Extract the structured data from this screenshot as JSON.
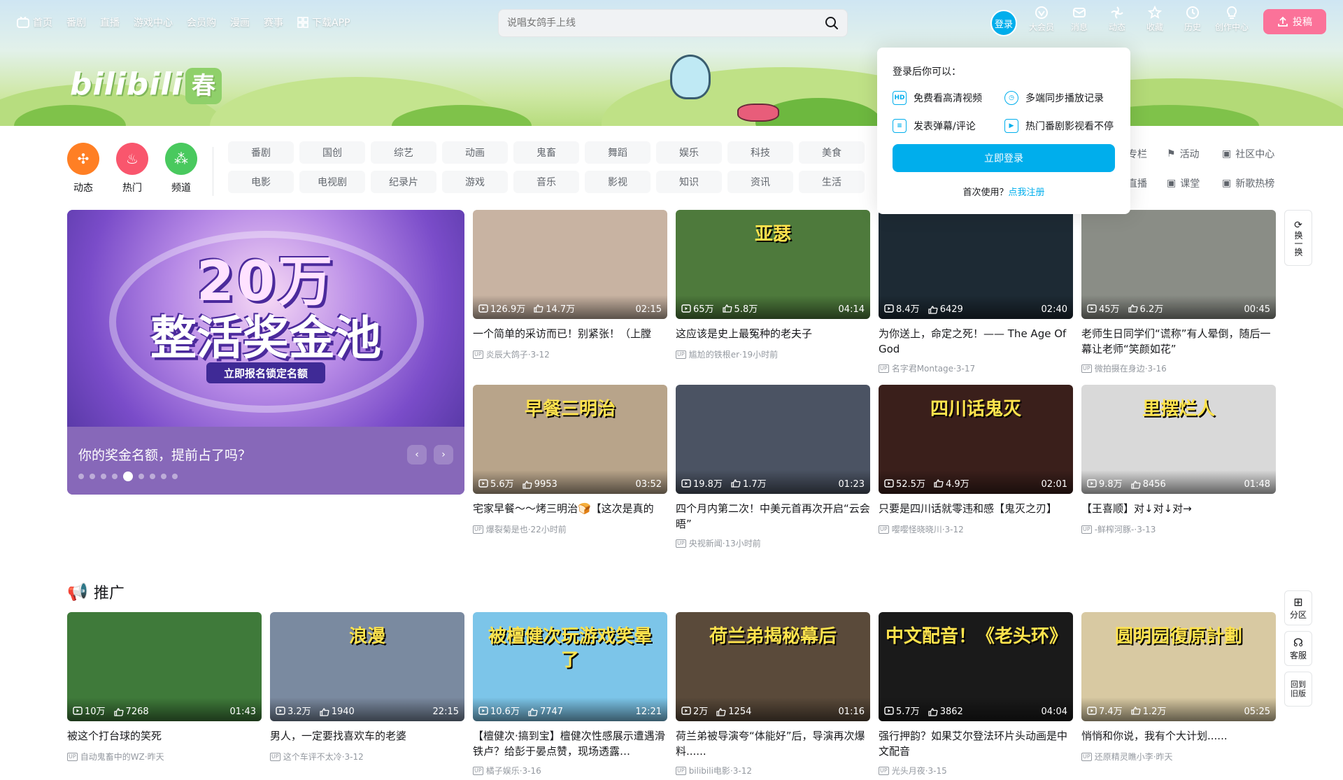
{
  "nav": {
    "items": [
      {
        "label": "首页",
        "icon": "tv-icon"
      },
      {
        "label": "番剧"
      },
      {
        "label": "直播"
      },
      {
        "label": "游戏中心"
      },
      {
        "label": "会员购"
      },
      {
        "label": "漫画"
      },
      {
        "label": "赛事"
      },
      {
        "label": "下载APP",
        "icon": "app-icon"
      }
    ],
    "search_placeholder": "说唱女鸽手上线",
    "login_label": "登录",
    "right": [
      {
        "label": "大会员",
        "icon": "vip-icon"
      },
      {
        "label": "消息",
        "icon": "message-icon"
      },
      {
        "label": "动态",
        "icon": "dynamic-icon"
      },
      {
        "label": "收藏",
        "icon": "star-icon"
      },
      {
        "label": "历史",
        "icon": "clock-icon"
      },
      {
        "label": "创作中心",
        "icon": "bulb-icon"
      }
    ],
    "upload_label": "投稿"
  },
  "banner": {
    "logo_text": "bilibili",
    "spring_char": "春"
  },
  "channels": [
    {
      "label": "动态",
      "color": "#ff7f24"
    },
    {
      "label": "热门",
      "color": "#f9566d"
    },
    {
      "label": "频道",
      "color": "#49c95e"
    }
  ],
  "categories_row1": [
    "番剧",
    "国创",
    "综艺",
    "动画",
    "鬼畜",
    "舞蹈",
    "娱乐",
    "科技",
    "美食"
  ],
  "categories_row2": [
    "电影",
    "电视剧",
    "纪录片",
    "游戏",
    "音乐",
    "影视",
    "知识",
    "资讯",
    "生活"
  ],
  "right_categories": [
    {
      "label": "专栏"
    },
    {
      "label": "活动"
    },
    {
      "label": "社区中心"
    },
    {
      "label": "直播"
    },
    {
      "label": "课堂"
    },
    {
      "label": "新歌热榜"
    }
  ],
  "carousel": {
    "headline1": "20万",
    "headline2": "整活奖金池",
    "sub": "立即报名锁定名额",
    "caption": "你的奖金名额，提前占了吗？",
    "dots_total": 9,
    "active_dot": 4
  },
  "feed": [
    {
      "views": "126.9万",
      "likes": "14.7万",
      "duration": "02:15",
      "title": "一个简单的采访而已！别紧张！（上膛",
      "author": "炎辰大鸽子",
      "date": "3-12",
      "bg": "#c8b3a2"
    },
    {
      "views": "65万",
      "likes": "5.8万",
      "duration": "04:14",
      "title": "这应该是史上最冤种的老夫子",
      "author": "尴尬的铁根er",
      "date": "19小时前",
      "bg": "#4e7a3c",
      "overlay": "亚瑟"
    },
    {
      "views": "8.4万",
      "likes": "6429",
      "duration": "02:40",
      "title": "为你送上，命定之死！—— The Age Of God",
      "author": "名字君Montage",
      "date": "3-17",
      "bg": "#1d2a34"
    },
    {
      "views": "45万",
      "likes": "6.2万",
      "duration": "00:45",
      "title": "老师生日同学们“谎称”有人晕倒，随后一幕让老师“笑颜如花”",
      "author": "微拍摄在身边",
      "date": "3-16",
      "bg": "#8a8d86"
    },
    {
      "views": "5.6万",
      "likes": "9953",
      "duration": "03:52",
      "title": "宅家早餐～～烤三明治🍞【这次是真的",
      "author": "爆裂菊是也",
      "date": "22小时前",
      "bg": "#b8a48a",
      "overlay": "早餐三明治"
    },
    {
      "views": "19.8万",
      "likes": "1.7万",
      "duration": "01:23",
      "title": "四个月内第二次！中美元首再次开启“云会晤”",
      "author": "央视新闻",
      "date": "13小时前",
      "bg": "#4b5363"
    },
    {
      "views": "52.5万",
      "likes": "4.9万",
      "duration": "02:01",
      "title": "只要是四川话就零违和感【鬼灭之刃】",
      "author": "嘤嘤怪晓晓川",
      "date": "3-12",
      "bg": "#3a1f1b",
      "overlay": "四川话鬼灭"
    },
    {
      "views": "9.8万",
      "likes": "8456",
      "duration": "01:48",
      "title": "【王喜顺】对↓对↓对→",
      "author": "-鲜榨河豚-",
      "date": "3-13",
      "bg": "#d9d9d9",
      "overlay": "里摆烂人"
    }
  ],
  "promo": {
    "title": "推广",
    "items": [
      {
        "views": "10万",
        "likes": "7268",
        "duration": "01:43",
        "title": "被这个打台球的笑死",
        "author": "自动鬼畜中的WZ",
        "date": "昨天",
        "bg": "#3f7a3a"
      },
      {
        "views": "3.2万",
        "likes": "1940",
        "duration": "22:15",
        "title": "男人，一定要找喜欢车的老婆",
        "author": "这个车评不太冷",
        "date": "3-12",
        "bg": "#7a8aa0",
        "overlay": "浪漫"
      },
      {
        "views": "10.6万",
        "likes": "7747",
        "duration": "12:21",
        "title": "【檀健次·搞到宝】檀健次性感展示遭遇滑铁卢？给彭于晏点赞，现场透露…",
        "author": "橘子娱乐",
        "date": "3-16",
        "bg": "#7cc5e9",
        "overlay": "被檀健次玩游戏笑晕了"
      },
      {
        "views": "2万",
        "likes": "1254",
        "duration": "01:16",
        "title": "荷兰弟被导演夸“体能好”后，导演再次爆料......",
        "author": "bilibili电影",
        "date": "3-12",
        "bg": "#5a4a3a",
        "overlay": "荷兰弟揭秘幕后"
      },
      {
        "views": "5.7万",
        "likes": "3862",
        "duration": "04:04",
        "title": "强行押韵？如果艾尔登法环片头动画是中文配音",
        "author": "光头月夜",
        "date": "3-15",
        "bg": "#1a1a1a",
        "overlay": "中文配音！《老头环》"
      },
      {
        "views": "7.4万",
        "likes": "1.2万",
        "duration": "05:25",
        "title": "悄悄和你说，我有个大计划......",
        "author": "还原精灵瞧小李",
        "date": "昨天",
        "bg": "#d8c9a2",
        "overlay": "圆明园復原計劃"
      }
    ]
  },
  "popup": {
    "title": "登录后你可以：",
    "features": [
      {
        "label": "免费看高清视频",
        "icon": "hd-icon"
      },
      {
        "label": "多端同步播放记录",
        "icon": "clock-icon"
      },
      {
        "label": "发表弹幕/评论",
        "icon": "danmaku-icon"
      },
      {
        "label": "热门番剧影视看不停",
        "icon": "play-icon"
      }
    ],
    "login_button": "立即登录",
    "first_use": "首次使用？",
    "register_link": "点我注册"
  },
  "side": {
    "refresh": "换一换",
    "partition": "分区",
    "service": "客服",
    "old": "回到旧版"
  }
}
